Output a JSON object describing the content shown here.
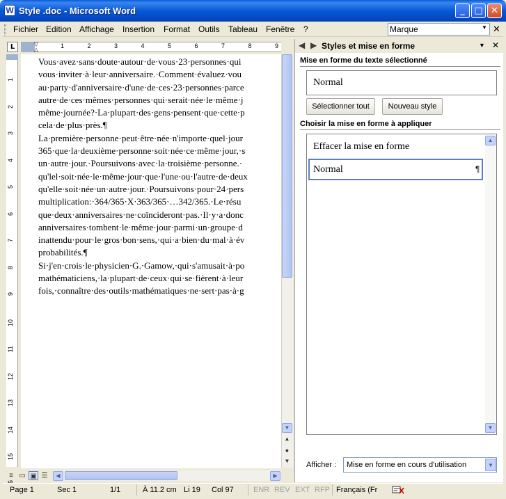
{
  "window": {
    "title": "Style .doc - Microsoft Word",
    "icon": "W",
    "controls": {
      "minimize": "_",
      "maximize": "□",
      "close": "✕"
    }
  },
  "menu": {
    "items": [
      "Fichier",
      "Edition",
      "Affichage",
      "Insertion",
      "Format",
      "Outils",
      "Tableau",
      "Fenêtre",
      "?"
    ],
    "search_value": "Marque",
    "search_arrow": "▼",
    "close_doc": "✕"
  },
  "ruler": {
    "corner": "L",
    "h_labels": [
      "1",
      "2",
      "3",
      "4",
      "5",
      "6",
      "7",
      "8",
      "9"
    ],
    "v_labels": [
      "1",
      "2",
      "3",
      "4",
      "5",
      "6",
      "7",
      "8",
      "9",
      "10",
      "11",
      "12",
      "13",
      "14",
      "15",
      "16"
    ]
  },
  "document": {
    "lines": [
      "Vous·avez·sans·doute·autour·de·vous·23·personnes·qui",
      "vous·inviter·à·leur·anniversaire.·Comment·évaluez·vou",
      "au·party·d'anniversaire·d'une·de·ces·23·personnes·parce",
      "autre·de·ces·mêmes·personnes·qui·serait·née·le·même·j",
      "même·journée?·La·plupart·des·gens·pensent·que·cette·p",
      "cela·de·plus·près.¶",
      "La·première·personne·peut·être·née·n'importe·quel·jour",
      "365·que·la·deuxième·personne·soit·née·ce·même·jour,·s",
      "un·autre·jour.·Poursuivons·avec·la·troisième·personne.·",
      "qu'lel·soit·née·le·même·jour·que·l'une·ou·l'autre·de·deux",
      "qu'elle·soit·née·un·autre·jour.·Poursuivons·pour·24·pers",
      "multiplication:·364/365·X·363/365·…342/365.·Le·résu",
      "que·deux·anniversaires·ne·coïncideront·pas.·Il·y·a·donc",
      "anniversaires·tombent·le·même·jour·parmi·un·groupe·d",
      "inattendu·pour·le·gros·bon·sens,·qui·a·bien·du·mal·à·év",
      "probabilités.¶",
      "Si·j'en·crois·le·physicien·G.·Gamow,·qui·s'amusait·à·po",
      "mathématiciens,·la·plupart·de·ceux·qui·se·fièrent·à·leur",
      "fois,·connaître·des·outils·mathématiques·ne·sert·pas·à·g"
    ]
  },
  "task_pane": {
    "title": "Styles et mise en forme",
    "nav_back": "◀",
    "nav_forward": "▶",
    "menu_arrow": "▼",
    "close": "✕",
    "selected_section_label": "Mise en forme du texte sélectionné",
    "current_style": "Normal",
    "select_all_button": "Sélectionner tout",
    "new_style_button": "Nouveau style",
    "apply_section_label": "Choisir la mise en forme à appliquer",
    "styles_list": [
      {
        "label": "Effacer la mise en forme",
        "selected": false
      },
      {
        "label": "Normal",
        "selected": true,
        "mark": "¶"
      }
    ],
    "show_label": "Afficher :",
    "show_value": "Mise en forme en cours d'utilisation",
    "show_arrow": "▼"
  },
  "status_bar": {
    "page": "Page  1",
    "section": "Sec  1",
    "pages": "1/1",
    "position": "À  11.2 cm",
    "line": "Li  19",
    "column": "Col  97",
    "rec": "ENR",
    "rev": "REV",
    "ext": "EXT",
    "ovr": "RFP",
    "language": "Français (Fr"
  },
  "scroll": {
    "up": "▲",
    "down": "▼",
    "left": "◀",
    "right": "▶",
    "prev_page": "▲",
    "select_browse": "●",
    "next_page": "▼"
  },
  "views": [
    "≡",
    "▭",
    "▣",
    "☰"
  ],
  "colors": {
    "title_bar": "#0758d6",
    "task_pane_bg": "#ffffff",
    "chrome": "#ece9d8",
    "selection_border": "#5b7ec0"
  }
}
